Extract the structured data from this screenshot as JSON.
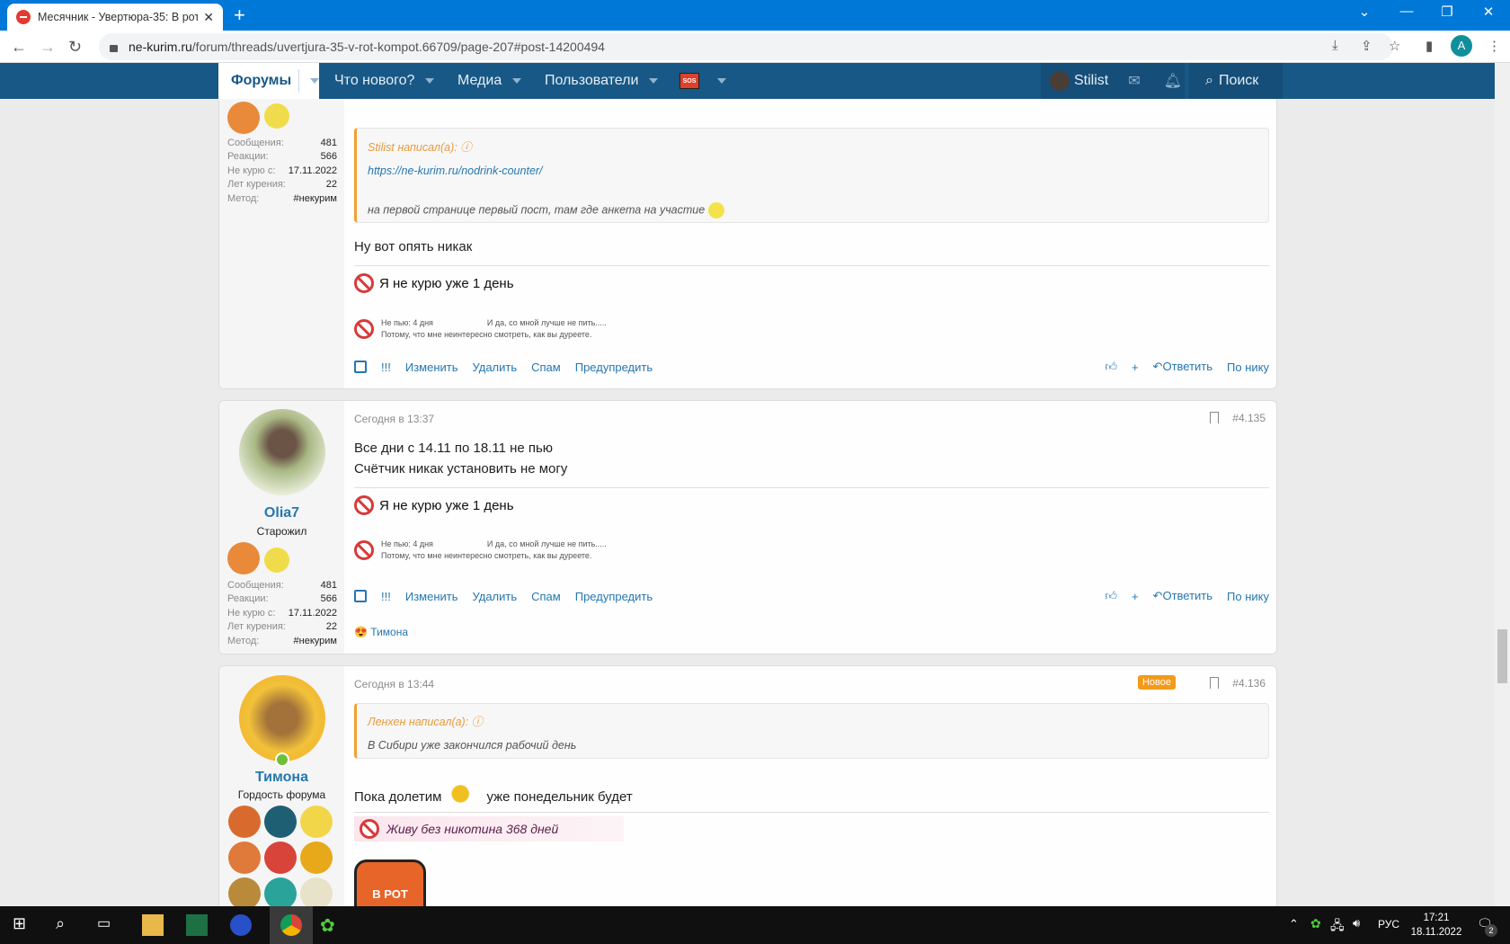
{
  "browser": {
    "tab_title": "Месячник - Увертюра-35: В рот",
    "url_host": "ne-kurim.ru",
    "url_path": "/forum/threads/uvertjura-35-v-rot-kompot.66709/page-207#post-14200494",
    "profile_letter": "A"
  },
  "nav": {
    "forums": "Форумы",
    "whats_new": "Что нового?",
    "media": "Медиа",
    "users": "Пользователи",
    "sos": "SOS",
    "user": "Stilist",
    "search": "Поиск"
  },
  "stat_labels": {
    "messages": "Сообщения:",
    "reactions": "Реакции:",
    "quit": "Не курю с:",
    "years": "Лет курения:",
    "method": "Метод:"
  },
  "actions": {
    "excl": "!!!",
    "edit": "Изменить",
    "delete": "Удалить",
    "spam": "Спам",
    "warn": "Предупредить",
    "plus": "+",
    "reply": "Ответить",
    "by_nick": "По нику"
  },
  "posts": [
    {
      "stats": {
        "messages": "481",
        "reactions": "566",
        "quit": "17.11.2022",
        "years": "22",
        "method": "#некурим"
      },
      "quote": {
        "author": "Stilist написал(а):",
        "link": "https://ne-kurim.ru/nodrink-counter/",
        "text": "на первой странице первый пост, там где анкета на участие"
      },
      "body": "Ну вот опять никак",
      "sig": "Я не курю уже  1 день",
      "sig2_a": "Не пью: 4 дня",
      "sig2_b": "И да, со мной лучше не пить.....",
      "sig2_c": "Потому, что мне неинтересно смотреть, как вы дуреете."
    },
    {
      "user": "Olia7",
      "title": "Старожил",
      "date": "Сегодня в 13:37",
      "num": "#4.135",
      "stats": {
        "messages": "481",
        "reactions": "566",
        "quit": "17.11.2022",
        "years": "22",
        "method": "#некурим"
      },
      "body1": "Все дни с 14.11 по 18.11 не пью",
      "body2": "Счётчик никак установить не могу",
      "sig": "Я не курю уже  1 день",
      "sig2_a": "Не пью: 4 дня",
      "sig2_b": "И да, со мной лучше не пить.....",
      "sig2_c": "Потому, что мне неинтересно смотреть, как вы дуреете.",
      "reaction_user": "Тимона"
    },
    {
      "user": "Тимона",
      "title": "Гордость форума",
      "date": "Сегодня в 13:44",
      "num": "#4.136",
      "badge_new": "Новое",
      "quote": {
        "author": "Ленхен написал(а):",
        "text": "В Сибири уже закончился рабочий день"
      },
      "body_a": "Пока долетим",
      "body_b": "уже понедельник будет",
      "sig": "Живу без никотина 368 дней",
      "jar_text": "В РОТ"
    }
  ],
  "taskbar": {
    "lang": "РУС",
    "time": "17:21",
    "date": "18.11.2022",
    "notifications": "2"
  }
}
